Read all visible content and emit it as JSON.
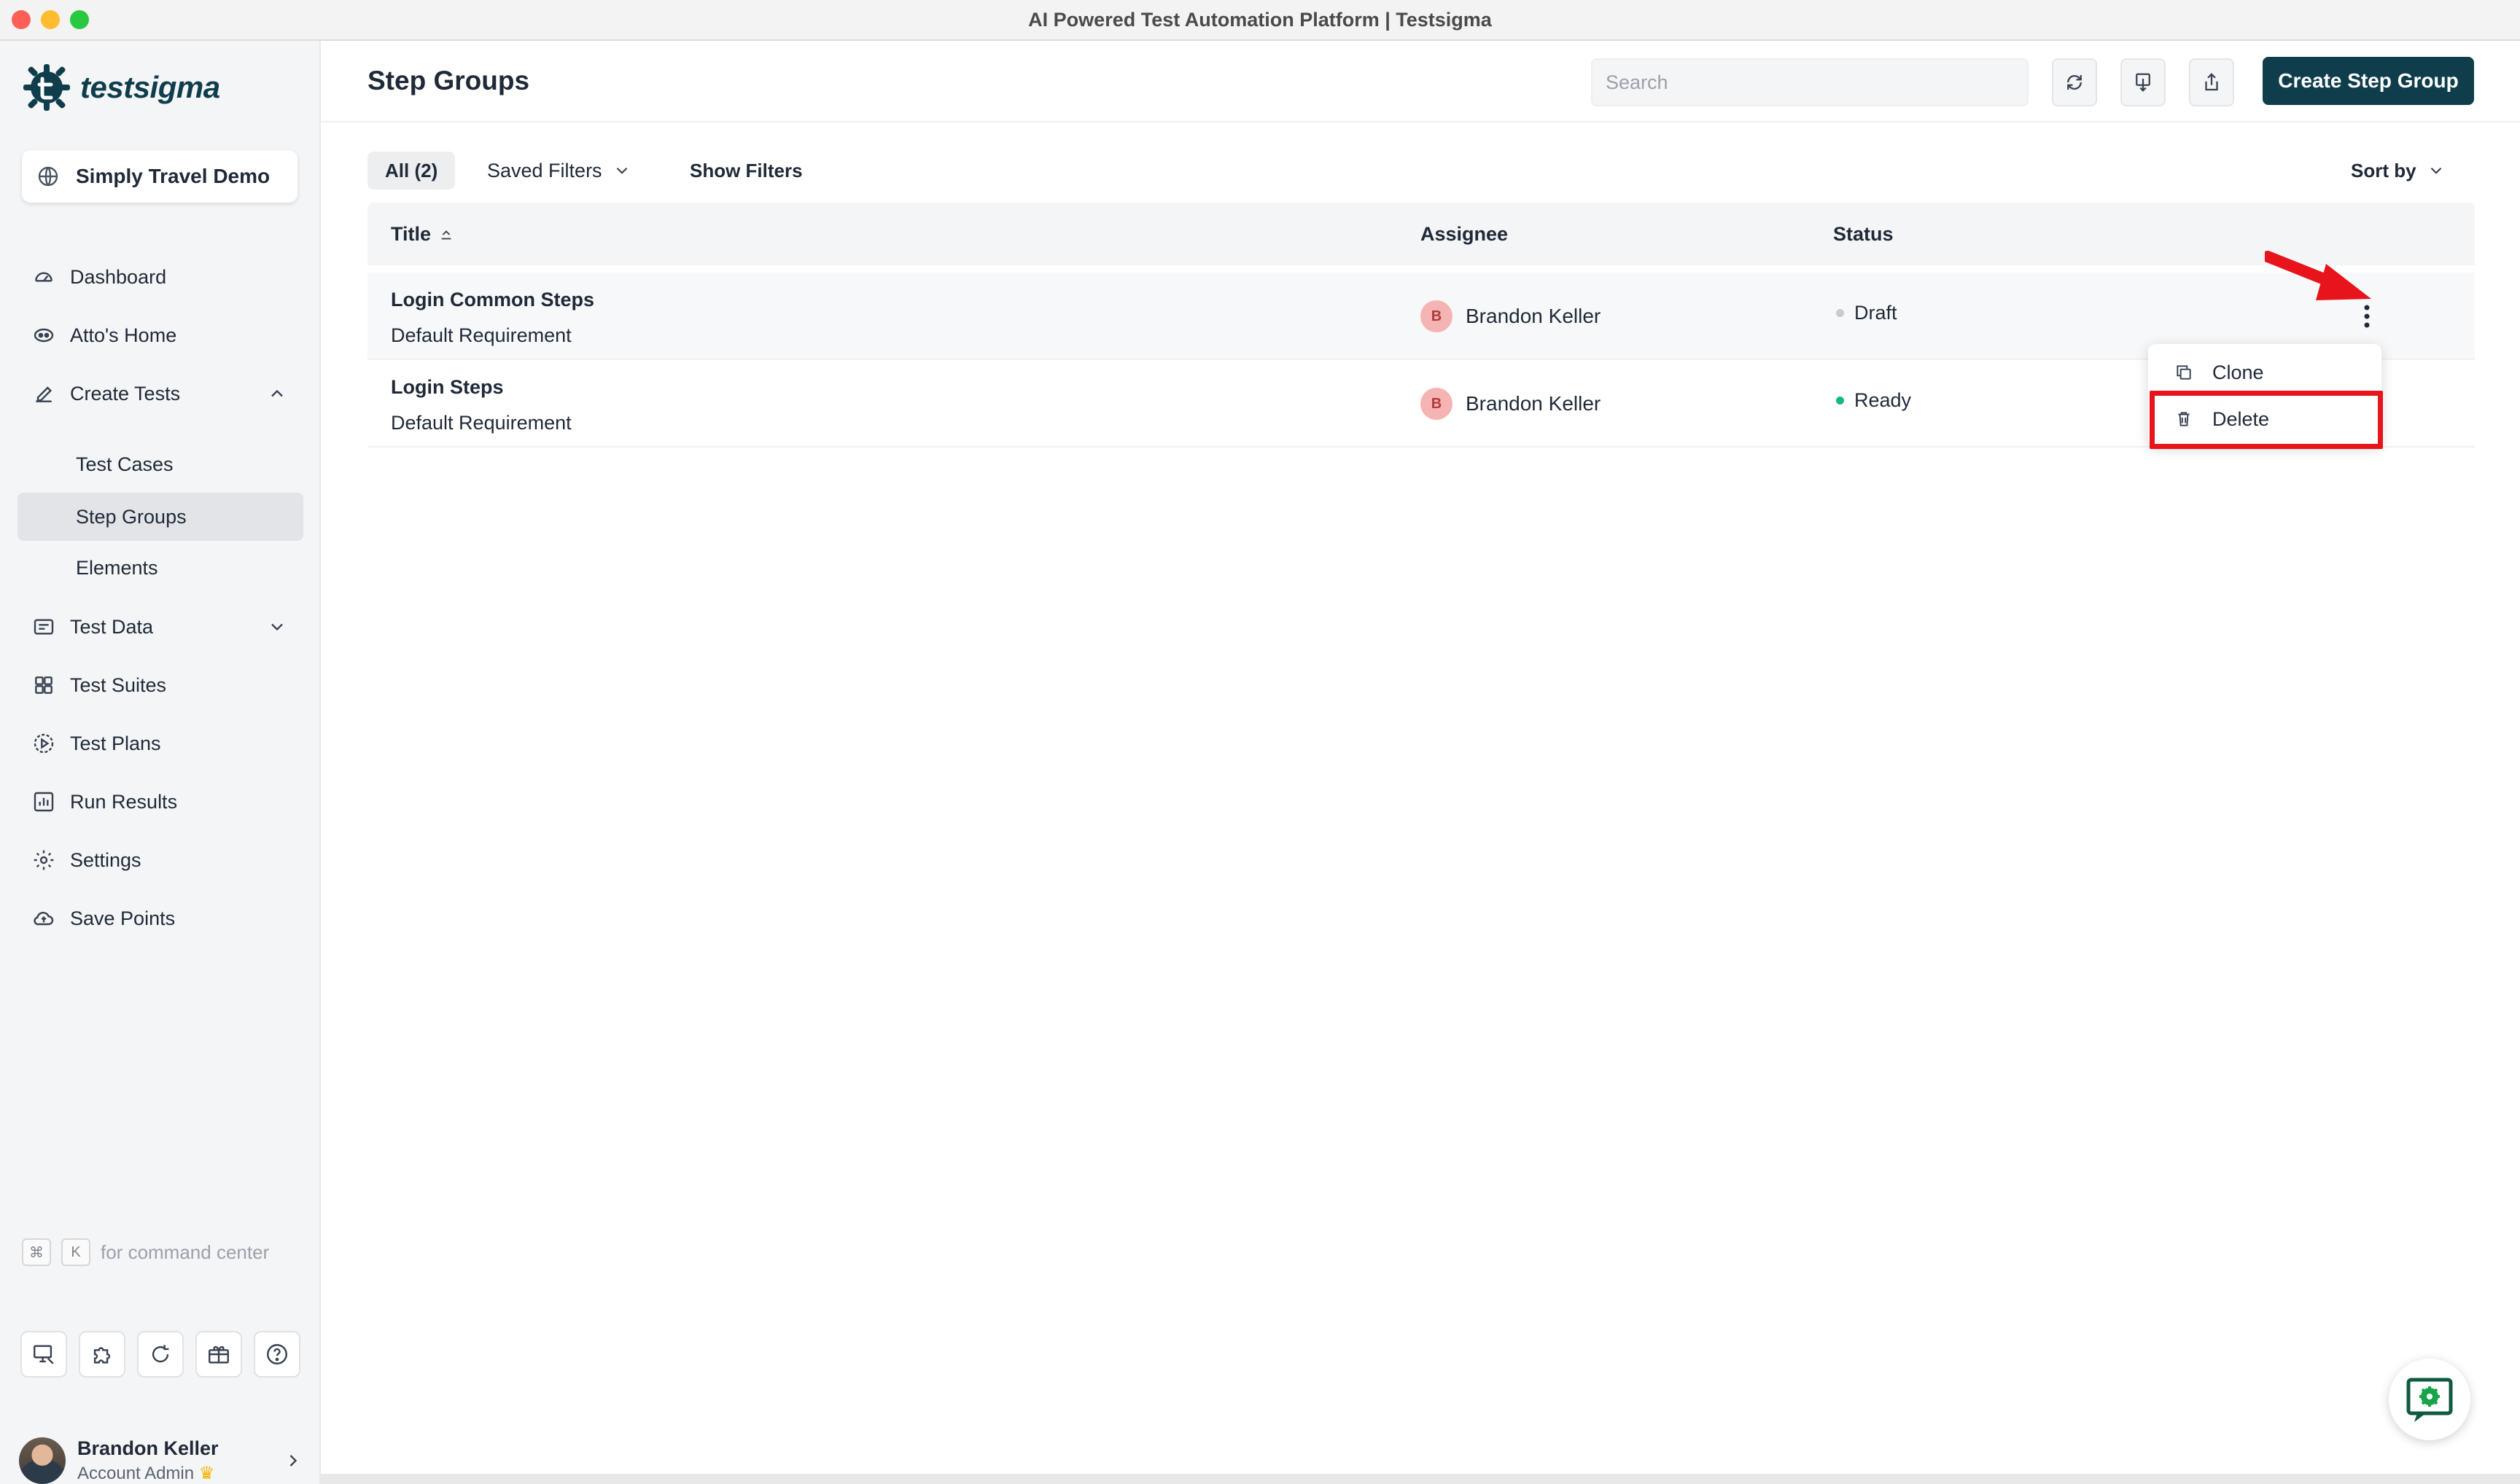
{
  "window": {
    "title": "AI Powered Test Automation Platform | Testsigma"
  },
  "brand": {
    "name": "testsigma",
    "accent": "#0f3d4c"
  },
  "sidebar": {
    "project": "Simply Travel Demo",
    "items": [
      {
        "label": "Dashboard",
        "icon": "speedometer-icon"
      },
      {
        "label": "Atto's Home",
        "icon": "robot-icon"
      },
      {
        "label": "Create Tests",
        "icon": "pencil-icon",
        "expanded": true
      },
      {
        "label": "Test Data",
        "icon": "folder-icon",
        "expanded": false
      },
      {
        "label": "Test Suites",
        "icon": "grid-icon"
      },
      {
        "label": "Test Plans",
        "icon": "play-circle-icon"
      },
      {
        "label": "Run Results",
        "icon": "bar-chart-icon"
      },
      {
        "label": "Settings",
        "icon": "gear-icon"
      },
      {
        "label": "Save Points",
        "icon": "cloud-icon"
      }
    ],
    "subitems": [
      {
        "label": "Test Cases"
      },
      {
        "label": "Step Groups",
        "active": true
      },
      {
        "label": "Elements"
      }
    ],
    "command_hint": {
      "key1": "⌘",
      "key2": "K",
      "text": "for command center"
    },
    "user": {
      "name": "Brandon Keller",
      "role": "Account Admin"
    }
  },
  "header": {
    "title": "Step Groups",
    "search_placeholder": "Search",
    "create_button": "Create Step Group"
  },
  "filters": {
    "all": "All (2)",
    "saved_filters": "Saved Filters",
    "show_filters": "Show Filters",
    "sort_by": "Sort by"
  },
  "table": {
    "columns": {
      "title": "Title",
      "assignee": "Assignee",
      "status": "Status"
    },
    "rows": [
      {
        "title": "Login Common Steps",
        "requirement": "Default Requirement",
        "assignee_initial": "B",
        "assignee": "Brandon Keller",
        "status": "Draft",
        "status_color": "#c7cbd0"
      },
      {
        "title": "Login Steps",
        "requirement": "Default Requirement",
        "assignee_initial": "B",
        "assignee": "Brandon Keller",
        "status": "Ready",
        "status_color": "#19b87a"
      }
    ]
  },
  "context_menu": {
    "clone": "Clone",
    "delete": "Delete"
  },
  "annotation": {
    "highlight_color": "#e8141c"
  }
}
